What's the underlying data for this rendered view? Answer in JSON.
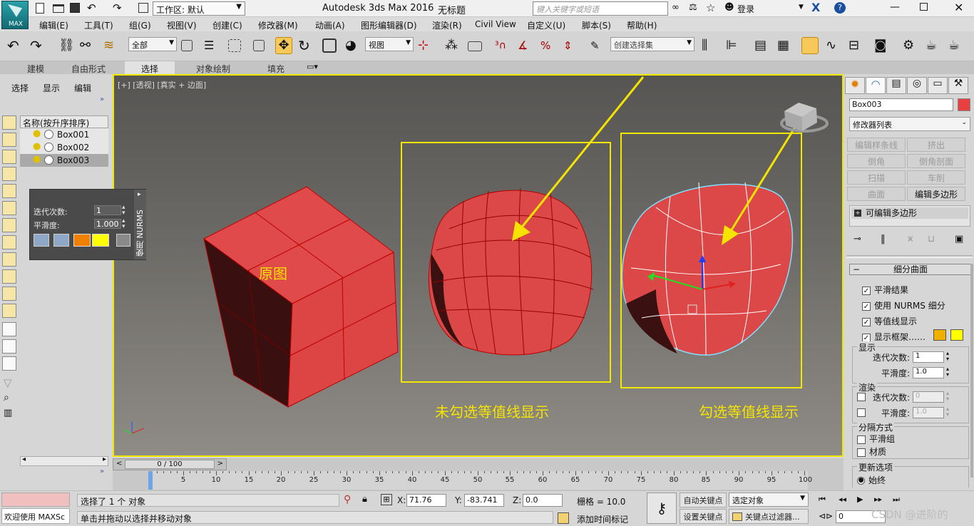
{
  "titlebar": {
    "workspace_label": "工作区: 默认",
    "app_title": "Autodesk 3ds Max 2016",
    "doc_title": "无标题",
    "search_placeholder": "键入关键字或短语",
    "login_label": "登录",
    "max_logo": "MAX"
  },
  "menu": [
    "编辑(E)",
    "工具(T)",
    "组(G)",
    "视图(V)",
    "创建(C)",
    "修改器(M)",
    "动画(A)",
    "图形编辑器(D)",
    "渲染(R)",
    "Civil View",
    "自定义(U)",
    "脚本(S)",
    "帮助(H)"
  ],
  "toolbar": {
    "selection_filter": "全部",
    "ref_coord": "视图",
    "selection_set_placeholder": "创建选择集"
  },
  "ribbon_tabs": [
    "建模",
    "自由形式",
    "选择",
    "对象绘制",
    "填充"
  ],
  "scene_explorer": {
    "tabs": [
      "选择",
      "显示",
      "编辑"
    ],
    "column_header": "名称(按升序排序)",
    "objects": [
      "Box001",
      "Box002",
      "Box003"
    ]
  },
  "nurms_panel": {
    "title": "使用 NURMS",
    "iterations_label": "迭代次数:",
    "iterations_value": "1",
    "smoothness_label": "平滑度:",
    "smoothness_value": "1.000",
    "colors": [
      "#f08000",
      "#ffff00"
    ]
  },
  "viewport": {
    "label": "[+] [透视] [真实 + 边面]",
    "annotation_original": "原图",
    "annotation_unchecked": "未勾选等值线显示",
    "annotation_checked": "勾选等值线显示",
    "highlight_color": "#f1e800"
  },
  "command_panel": {
    "object_name": "Box003",
    "object_color": "#e84040",
    "modifier_list": "修改器列表",
    "buttons": [
      "编辑样条线",
      "挤出",
      "倒角",
      "倒角剖面",
      "扫描",
      "车削",
      "曲面",
      "编辑多边形"
    ],
    "stack_item": "可编辑多边形",
    "rollout_title": "细分曲面",
    "options": [
      {
        "label": "平滑结果",
        "checked": true
      },
      {
        "label": "使用 NURMS 细分",
        "checked": true
      },
      {
        "label": "等值线显示",
        "checked": true
      },
      {
        "label": "显示框架……",
        "checked": true
      }
    ],
    "display_group": "显示",
    "iterations_label": "迭代次数:",
    "display_iterations": "1",
    "smoothness_label": "平滑度:",
    "display_smoothness": "1.0",
    "render_group": "渲染",
    "render_iterations": "0",
    "render_smoothness": "1.0",
    "separate_group": "分隔方式",
    "separate_options": [
      "平滑组",
      "材质"
    ],
    "update_group": "更新选项",
    "update_option": "始终"
  },
  "timeline": {
    "position": "0 / 100",
    "ticks": [
      "0",
      "5",
      "10",
      "15",
      "20",
      "25",
      "30",
      "35",
      "40",
      "45",
      "50",
      "55",
      "60",
      "65",
      "70",
      "75",
      "80",
      "85",
      "90",
      "95",
      "100"
    ]
  },
  "status": {
    "maxscript": "欢迎使用 MAXSc",
    "selected": "选择了 1 个 对象",
    "prompt": "单击并拖动以选择并移动对象",
    "x_label": "X:",
    "x_value": "71.76",
    "y_label": "Y:",
    "y_value": "-83.741",
    "z_label": "Z:",
    "z_value": "0.0",
    "grid": "栅格 = 10.0",
    "add_time_tag": "添加时间标记",
    "auto_key": "自动关键点",
    "set_key": "设置关键点",
    "selected_object": "选定对象",
    "key_filter": "关键点过滤器...",
    "frame": "0",
    "watermark": "CSDN @进阶的"
  }
}
